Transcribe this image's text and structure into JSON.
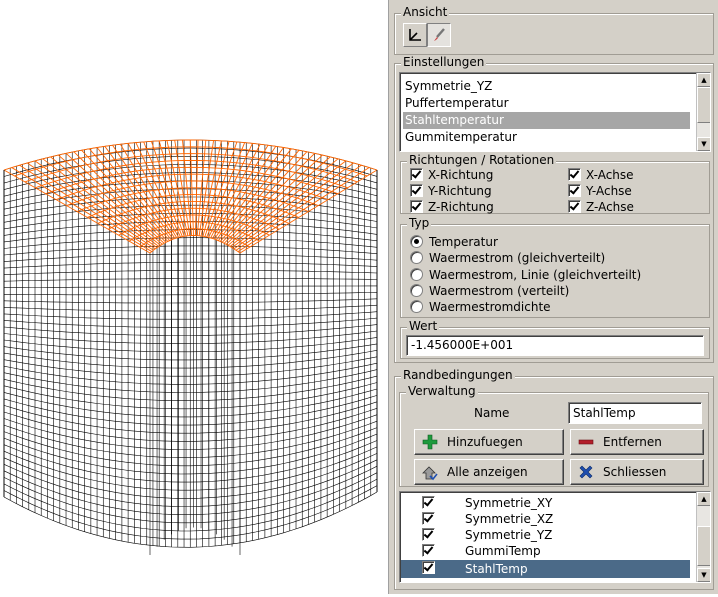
{
  "panel": {
    "ansicht": {
      "title": "Ansicht",
      "tools": [
        "axes-icon",
        "brush-icon"
      ],
      "active_tool": "brush-icon"
    },
    "einstellungen": {
      "title": "Einstellungen",
      "list": [
        "Symmetrie_YZ",
        "Puffertemperatur",
        "Stahltemperatur",
        "Gummitemperatur"
      ],
      "selected": "Stahltemperatur",
      "richtungen": {
        "title": "Richtungen / Rotationen",
        "left": [
          "X-Richtung",
          "Y-Richtung",
          "Z-Richtung"
        ],
        "right": [
          "X-Achse",
          "Y-Achse",
          "Z-Achse"
        ]
      },
      "typ": {
        "title": "Typ",
        "options": [
          "Temperatur",
          "Waermestrom (gleichverteilt)",
          "Waermestrom, Linie (gleichverteilt)",
          "Waermestrom (verteilt)",
          "Waermestromdichte"
        ],
        "selected": "Temperatur"
      },
      "wert": {
        "title": "Wert",
        "value": "-1.456000E+001"
      }
    },
    "randbedingungen": {
      "title": "Randbedingungen",
      "verwaltung": {
        "title": "Verwaltung",
        "name_label": "Name",
        "name_value": "StahlTemp",
        "buttons": {
          "add": "Hinzufuegen",
          "remove": "Entfernen",
          "show_all": "Alle anzeigen",
          "close": "Schliessen"
        },
        "list": [
          "Symmetrie_XY",
          "Symmetrie_XZ",
          "Symmetrie_YZ",
          "GummiTemp",
          "StahlTemp"
        ],
        "selected": "StahlTemp"
      }
    }
  },
  "colors": {
    "highlight": "#ff6600",
    "selection": "#4b6a88",
    "list_grey": "#a6a6a6",
    "panel_bg": "#d4d0c8"
  }
}
